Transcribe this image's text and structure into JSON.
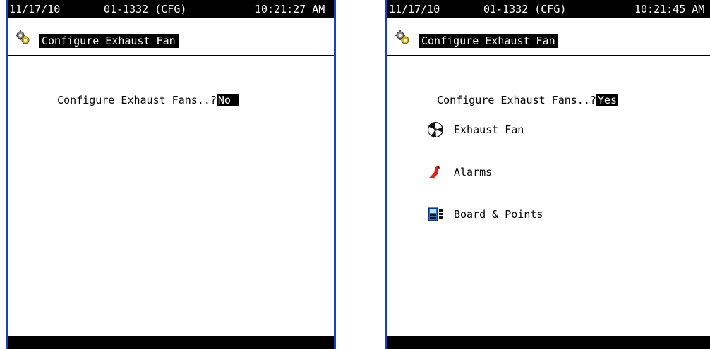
{
  "screens": [
    {
      "status_bar": {
        "date": "11/17/10",
        "unit": "01-1332 (CFG)",
        "time": "10:21:27 AM"
      },
      "title": "Configure Exhaust Fan",
      "question": {
        "label": "Configure Exhaust Fans..?",
        "value": "No "
      }
    },
    {
      "status_bar": {
        "date": "11/17/10",
        "unit": "01-1332 (CFG)",
        "time": "10:21:45 AM"
      },
      "title": "Configure Exhaust Fan",
      "question": {
        "label": "Configure Exhaust Fans..?",
        "value": "Yes"
      },
      "menu": [
        {
          "label": "Exhaust Fan",
          "icon": "fan-icon"
        },
        {
          "label": "Alarms",
          "icon": "alarm-bird-icon"
        },
        {
          "label": "Board & Points",
          "icon": "board-icon"
        }
      ]
    }
  ],
  "colors": {
    "frame": "#1a3fbf",
    "bar": "#000000",
    "alarm_red": "#e02020",
    "board_blue": "#2a6fd6"
  }
}
